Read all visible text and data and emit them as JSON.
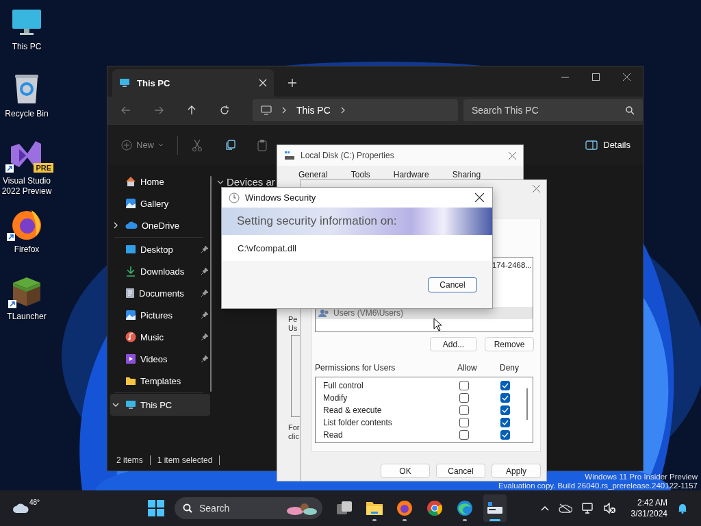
{
  "desktop": {
    "icons": [
      {
        "kind": "pc",
        "label": "This PC",
        "shortcut": false
      },
      {
        "kind": "bin",
        "label": "Recycle Bin",
        "shortcut": false
      },
      {
        "kind": "vs",
        "label": "Visual Studio 2022 Preview",
        "badge": "PRE",
        "shortcut": true
      },
      {
        "kind": "firefox",
        "label": "Firefox",
        "shortcut": true
      },
      {
        "kind": "block",
        "label": "TLauncher",
        "shortcut": true
      }
    ],
    "watermark": [
      "Windows 11 Pro Insider Preview",
      "Evaluation copy. Build 26040.rs_prerelease.240122-1157"
    ]
  },
  "explorer": {
    "tab": "This PC",
    "address": "This PC",
    "search": {
      "placeholder": "Search This PC"
    },
    "toolbar": {
      "new": "New",
      "details": "Details"
    },
    "sidebar": {
      "top": [
        {
          "kind": "home",
          "label": "Home",
          "selected": false
        },
        {
          "kind": "gallery",
          "label": "Gallery",
          "selected": false
        },
        {
          "kind": "cloud",
          "label": "OneDrive",
          "selected": false,
          "expanded": false
        }
      ],
      "quick": [
        {
          "kind": "desktop",
          "label": "Desktop",
          "pinned": true,
          "selected": false
        },
        {
          "kind": "downloads",
          "label": "Downloads",
          "pinned": true,
          "selected": false
        },
        {
          "kind": "documents",
          "label": "Documents",
          "pinned": true,
          "selected": false
        },
        {
          "kind": "pictures",
          "label": "Pictures",
          "pinned": true,
          "selected": false
        },
        {
          "kind": "music",
          "label": "Music",
          "pinned": true,
          "selected": false
        },
        {
          "kind": "videos",
          "label": "Videos",
          "pinned": true,
          "selected": false
        },
        {
          "kind": "folder",
          "label": "Templates",
          "pinned": false,
          "selected": false
        }
      ],
      "bottom": [
        {
          "kind": "pc",
          "label": "This PC",
          "selected": true,
          "expanded": true
        }
      ]
    },
    "section": "Devices ar",
    "status": [
      "2 items",
      "1 item selected"
    ]
  },
  "properties": {
    "title": "Local Disk (C:) Properties",
    "tabs": [
      "General",
      "Tools",
      "Hardware",
      "Sharing"
    ],
    "fragments": [
      "Pe",
      "Us",
      "For",
      "clic"
    ]
  },
  "permissions": {
    "groups": [
      {
        "name": "174-2468...",
        "selected": false
      },
      {
        "name": "Users (VM6\\Users)",
        "selected": true
      }
    ],
    "buttons": [
      "Add...",
      "Remove"
    ],
    "header": "Permissions for Users",
    "columns": [
      "Allow",
      "Deny"
    ],
    "rows": [
      {
        "name": "Full control",
        "allow": false,
        "deny": true
      },
      {
        "name": "Modify",
        "allow": false,
        "deny": true
      },
      {
        "name": "Read & execute",
        "allow": false,
        "deny": true
      },
      {
        "name": "List folder contents",
        "allow": false,
        "deny": true
      },
      {
        "name": "Read",
        "allow": false,
        "deny": true
      }
    ],
    "footer": [
      "OK",
      "Cancel",
      "Apply"
    ]
  },
  "security": {
    "title": "Windows Security",
    "heading": "Setting security information on:",
    "path": "C:\\vfcompat.dll",
    "button": "Cancel"
  },
  "taskbar": {
    "temperature": "48°",
    "search": "Search",
    "apps": [
      {
        "kind": "taskview",
        "running": false,
        "active": false
      },
      {
        "kind": "explorer",
        "running": true,
        "active": false
      },
      {
        "kind": "firefox",
        "running": true,
        "active": false
      },
      {
        "kind": "chrome",
        "running": false,
        "active": false
      },
      {
        "kind": "edge",
        "running": true,
        "active": false
      },
      {
        "kind": "server",
        "running": true,
        "active": true
      }
    ],
    "time": "2:42 AM",
    "date": "3/31/2024"
  }
}
